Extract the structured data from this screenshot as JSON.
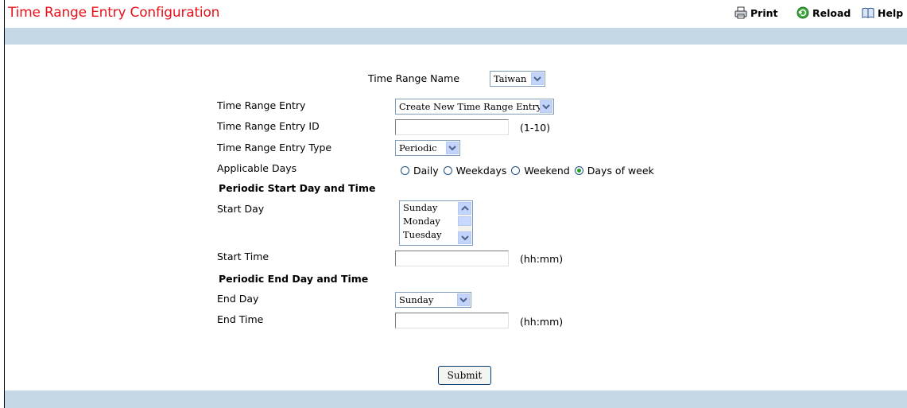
{
  "page_title": "Time Range Entry Configuration",
  "toolbar": {
    "print": "Print",
    "reload": "Reload",
    "help": "Help"
  },
  "colors": {
    "title": "#e8121b",
    "band": "#c5d8e6",
    "radio_selected": "#21a121"
  },
  "form": {
    "time_range_name": {
      "label": "Time Range Name",
      "value": "Taiwan"
    },
    "time_range_entry": {
      "label": "Time Range Entry",
      "value": "Create New Time Range Entry"
    },
    "time_range_entry_id": {
      "label": "Time Range Entry ID",
      "value": "",
      "hint": "(1-10)"
    },
    "time_range_entry_type": {
      "label": "Time Range Entry Type",
      "value": "Periodic"
    },
    "applicable_days": {
      "label": "Applicable Days",
      "options": [
        "Daily",
        "Weekdays",
        "Weekend",
        "Days of week"
      ],
      "selected": "Days of week"
    },
    "periodic_start_header": "Periodic Start Day and Time",
    "start_day": {
      "label": "Start Day",
      "options": [
        "Sunday",
        "Monday",
        "Tuesday"
      ]
    },
    "start_time": {
      "label": "Start Time",
      "value": "",
      "hint": "(hh:mm)"
    },
    "periodic_end_header": "Periodic End Day and Time",
    "end_day": {
      "label": "End Day",
      "value": "Sunday"
    },
    "end_time": {
      "label": "End Time",
      "value": "",
      "hint": "(hh:mm)"
    },
    "submit": "Submit"
  }
}
